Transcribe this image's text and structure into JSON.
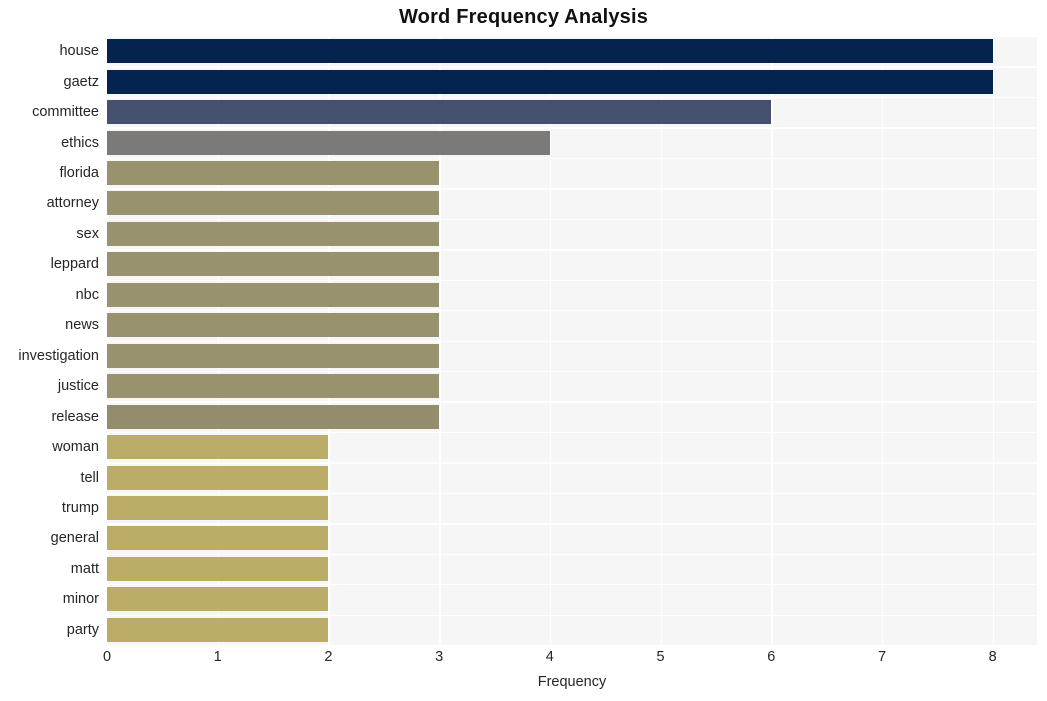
{
  "chart_data": {
    "type": "bar",
    "orientation": "horizontal",
    "title": "Word Frequency Analysis",
    "xlabel": "Frequency",
    "ylabel": "",
    "xlim": [
      0,
      8.4
    ],
    "xticks": [
      "0",
      "1",
      "2",
      "3",
      "4",
      "5",
      "6",
      "7",
      "8"
    ],
    "xtick_values": [
      0,
      1,
      2,
      3,
      4,
      5,
      6,
      7,
      8
    ],
    "grid": true,
    "legend": "none",
    "categories": [
      "house",
      "gaetz",
      "committee",
      "ethics",
      "florida",
      "attorney",
      "sex",
      "leppard",
      "nbc",
      "news",
      "investigation",
      "justice",
      "release",
      "woman",
      "tell",
      "trump",
      "general",
      "matt",
      "minor",
      "party"
    ],
    "values": [
      8,
      8,
      6,
      4,
      3,
      3,
      3,
      3,
      3,
      3,
      3,
      3,
      3,
      2,
      2,
      2,
      2,
      2,
      2,
      2
    ],
    "bar_colors": [
      "#04234f",
      "#04234f",
      "#454f6e",
      "#7b7a78",
      "#99926f",
      "#99926f",
      "#99926f",
      "#99926f",
      "#99926f",
      "#99926f",
      "#99926f",
      "#99926f",
      "#938d6d",
      "#bbac68",
      "#bbac68",
      "#bbac68",
      "#bbac68",
      "#bbac68",
      "#bbac68",
      "#bbac68"
    ],
    "plot_background": "#f6f6f7",
    "gridline_color": "#ffffff",
    "figure_background": "#ffffff"
  }
}
